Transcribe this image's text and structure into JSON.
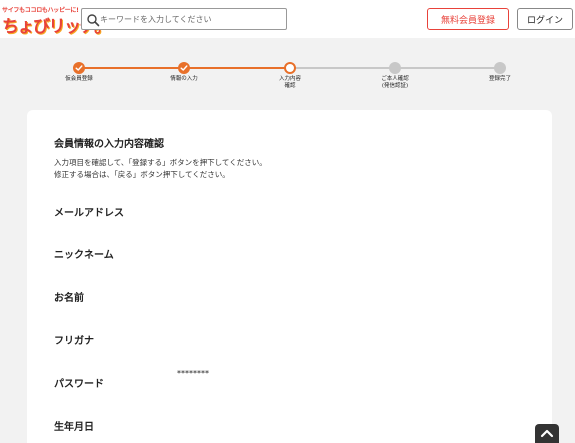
{
  "header": {
    "logo_tagline": "サイフもココロもハッピーに!",
    "logo_text": "ちょびリッチ。",
    "search": {
      "placeholder": "キーワードを入力してください",
      "value": ""
    },
    "register_label": "無料会員登録",
    "login_label": "ログイン"
  },
  "steps": [
    {
      "label": "仮会員登録",
      "status": "done"
    },
    {
      "label": "情報の入力",
      "status": "done"
    },
    {
      "label": "入力内容\n確認",
      "status": "current"
    },
    {
      "label": "ご本人確認\n(発信認証)",
      "status": "todo"
    },
    {
      "label": "登録完了",
      "status": "todo"
    }
  ],
  "confirm": {
    "title": "会員情報の入力内容確認",
    "description_line1": "入力項目を確認して、「登録する」ボタンを押下してください。",
    "description_line2": "修正する場合は、「戻る」ボタン押下してください。",
    "fields": [
      {
        "label": "メールアドレス",
        "value": ""
      },
      {
        "label": "ニックネーム",
        "value": ""
      },
      {
        "label": "お名前",
        "value": ""
      },
      {
        "label": "フリガナ",
        "value": ""
      },
      {
        "label": "パスワード",
        "value": "********"
      },
      {
        "label": "生年月日",
        "value": ""
      }
    ]
  },
  "colors": {
    "accent": "#e8423a",
    "step_active": "#e8702a",
    "step_inactive": "#c8c8c8",
    "background": "#f2f2f2"
  },
  "icons": {
    "search": "search-icon",
    "check": "check-icon",
    "scroll_top": "chevron-up-icon"
  }
}
